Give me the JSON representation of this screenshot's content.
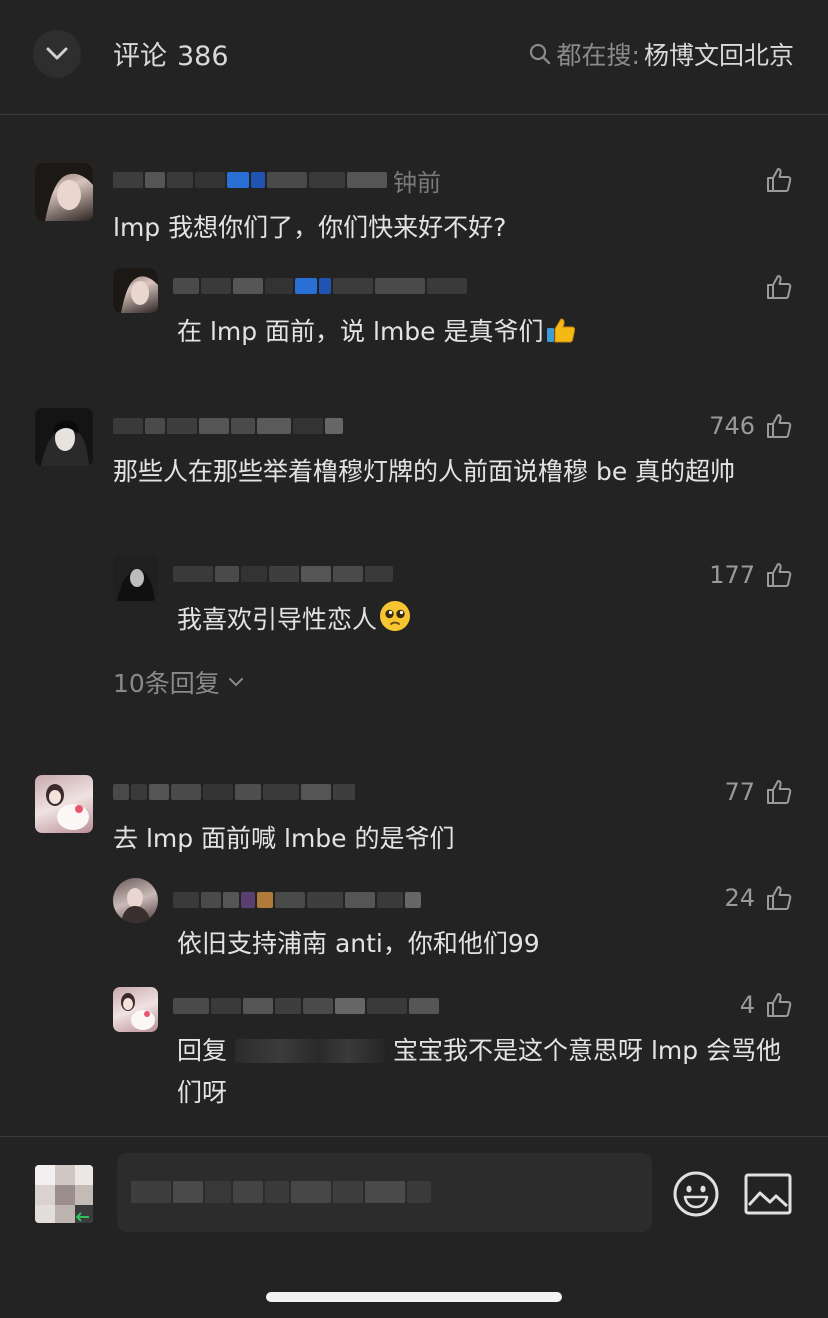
{
  "header": {
    "title": "评论",
    "count": "386",
    "search_prefix": "都在搜:",
    "search_term": "杨博文回北京"
  },
  "comments": [
    {
      "time": "钟前",
      "text": "lmp 我想你们了，你们快来好不好?",
      "likes": "",
      "reply": {
        "text": "在 lmp 面前，说 lmbe 是真爷们",
        "likes": ""
      }
    },
    {
      "text": "那些人在那些举着橹穆灯牌的人前面说橹穆 be 真的超帅",
      "likes": "746",
      "reply": {
        "text": "我喜欢引导性恋人",
        "likes": "177"
      },
      "more_replies": "10条回复"
    },
    {
      "text": "去 lmp 面前喊 lmbe 的是爷们",
      "likes": "77",
      "replies": [
        {
          "text": "依旧支持浦南 anti，你和他们99",
          "likes": "24"
        },
        {
          "text_before": "回复",
          "text_after": "宝宝我不是这个意思呀 lmp 会骂他们呀",
          "likes": "4"
        }
      ]
    }
  ],
  "colors": {
    "background": "#232323",
    "text": "#e3e3e3",
    "muted": "#8a8a8a",
    "divider": "#3a3a3a"
  },
  "icons": [
    "chevron-down-icon",
    "search-icon",
    "thumbs-up-icon",
    "emoji-smile-icon",
    "image-icon"
  ]
}
